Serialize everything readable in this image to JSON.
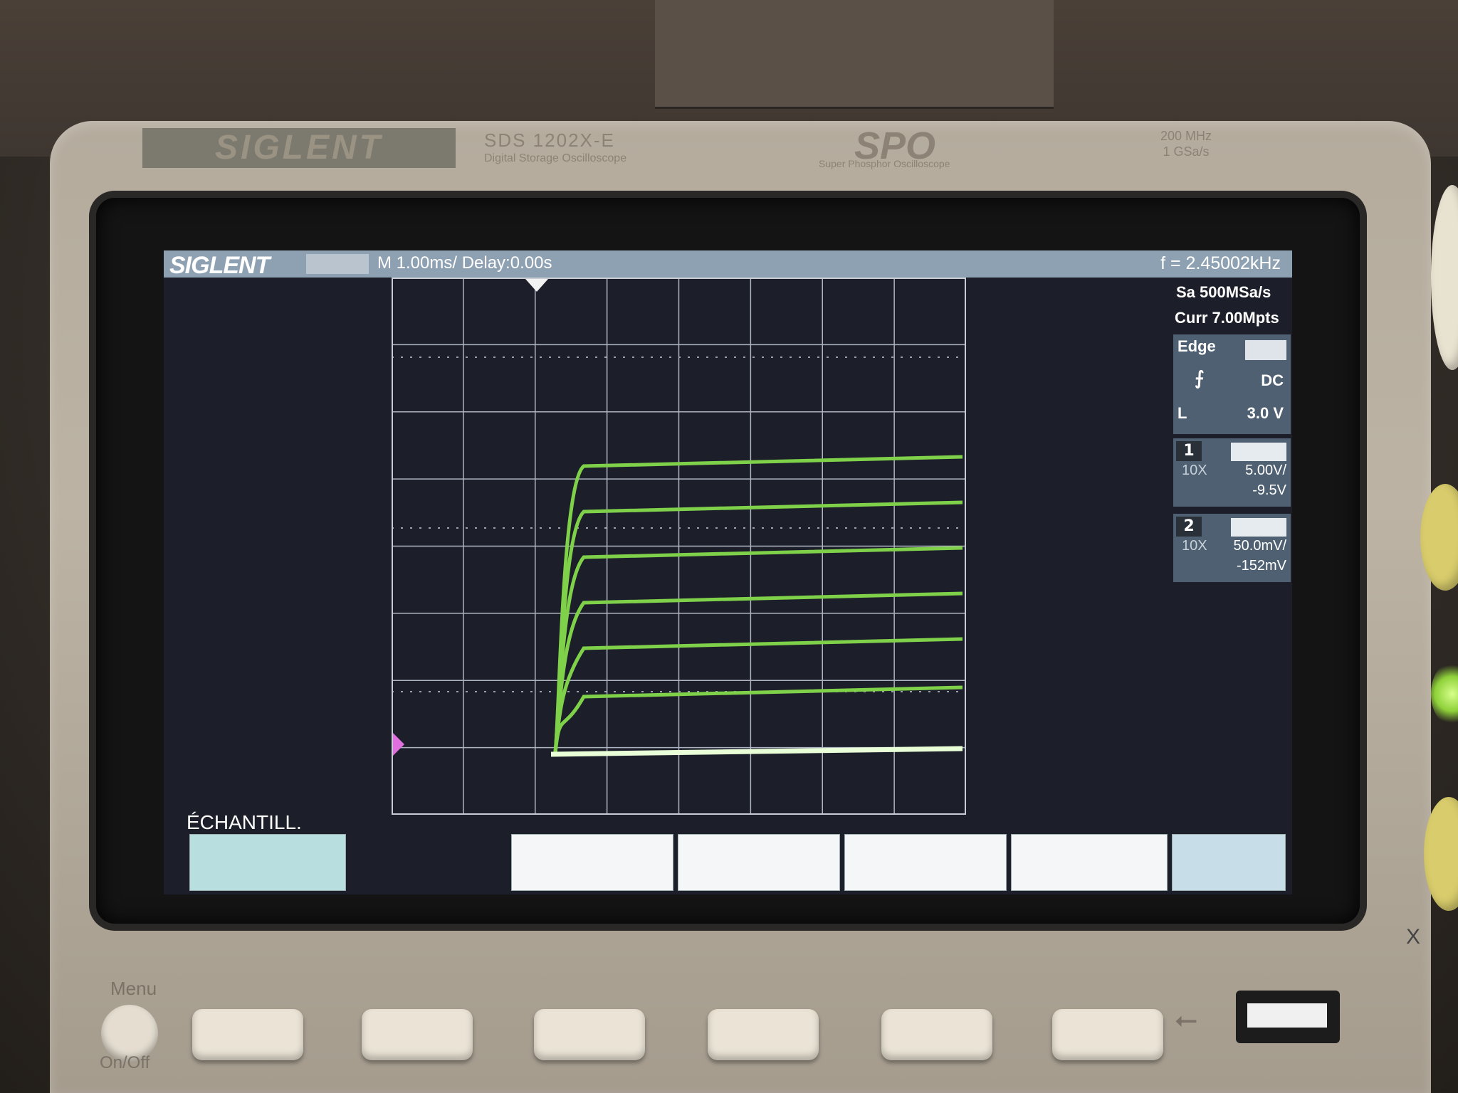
{
  "instrument": {
    "brand_logo": "SIGLENT",
    "model": "SDS 1202X-E",
    "model_sub": "Digital Storage Oscilloscope",
    "series_logo": "SPO",
    "series_sub": "Super Phosphor Oscilloscope",
    "bandwidth": "200 MHz",
    "sample_rate_spec": "1 GSa/s",
    "menu_label": "Menu",
    "power_label": "On/Off",
    "x_label": "X",
    "usb_symbol": "⭠",
    "colors": {
      "trace": "#7fd14a",
      "trace_bright": "#e8ffd8",
      "topbar": "#8ea1b3",
      "panel": "#4e6072"
    }
  },
  "screen": {
    "logo": "SIGLENT",
    "timebase": "M 1.00ms/ Delay:0.00s",
    "frequency": "f = 2.45002kHz",
    "sample_rate": "Sa 500MSa/s",
    "memory_depth": "Curr 7.00Mpts",
    "trigger": {
      "type": "Edge",
      "slope_icon": "rising-edge-icon",
      "coupling": "DC",
      "level_label": "L",
      "level": "3.0 V"
    },
    "channels": [
      {
        "num": "1",
        "probe": "10X",
        "scale": "5.00V/",
        "offset": "-9.5V"
      },
      {
        "num": "2",
        "probe": "10X",
        "scale": "50.0mV/",
        "offset": "-152mV"
      }
    ],
    "acquire_label": "ÉCHANTILL.",
    "softkeys": [
      "",
      "",
      "",
      "",
      "",
      ""
    ]
  }
}
